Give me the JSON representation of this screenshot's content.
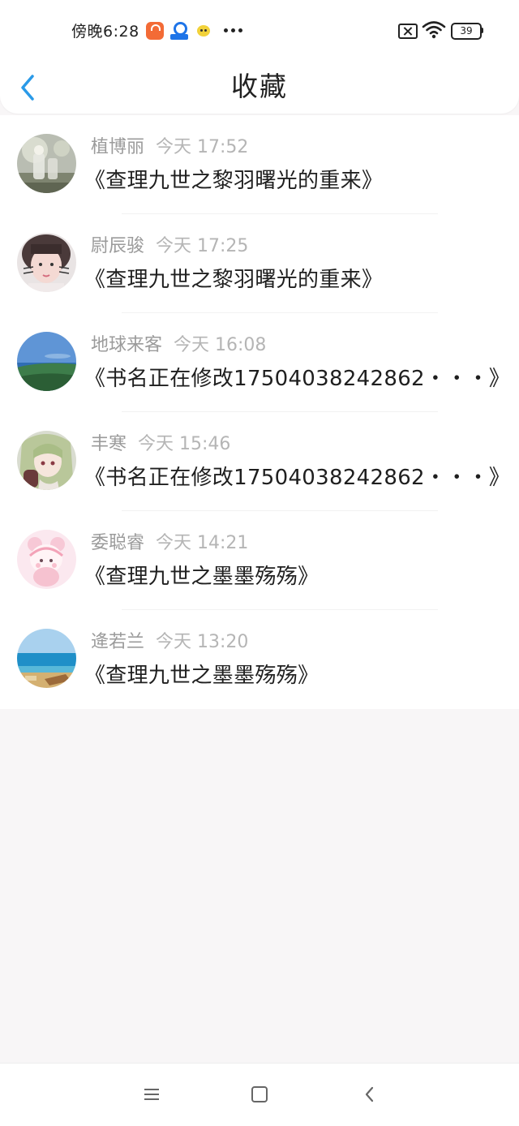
{
  "status_bar": {
    "time": "傍晚6:28",
    "battery_level": "39",
    "notification_icons": [
      "shopping-bag-icon",
      "hello-app-icon",
      "smiley-face-icon"
    ],
    "overflow_icon": "more-dots-icon",
    "system_icons": [
      "sim-off-icon",
      "wifi-icon",
      "battery-icon"
    ]
  },
  "header": {
    "title": "收藏",
    "back_icon": "chevron-left-icon",
    "accent_color": "#2a9ae8"
  },
  "favorites": [
    {
      "user": "植博丽",
      "time": "今天 17:52",
      "title": "《查理九世之黎羽曙光的重来》",
      "avatar": "glass-flower-photo"
    },
    {
      "user": "尉辰骏",
      "time": "今天 17:25",
      "title": "《查理九世之黎羽曙光的重来》",
      "avatar": "girl-selfie-photo"
    },
    {
      "user": "地球来客",
      "time": "今天 16:08",
      "title": "《书名正在修改17504038242862・・・》",
      "avatar": "coastline-photo"
    },
    {
      "user": "丰寒",
      "time": "今天 15:46",
      "title": "《书名正在修改17504038242862・・・》",
      "avatar": "anime-girl-illustration"
    },
    {
      "user": "委聪睿",
      "time": "今天 14:21",
      "title": "《查理九世之墨墨殇殇》",
      "avatar": "cartoon-bear-girl"
    },
    {
      "user": "逄若兰",
      "time": "今天 13:20",
      "title": "《查理九世之墨墨殇殇》",
      "avatar": "beach-photo"
    }
  ],
  "nav_bar": {
    "icons": [
      "menu-icon",
      "home-icon",
      "back-icon"
    ]
  }
}
